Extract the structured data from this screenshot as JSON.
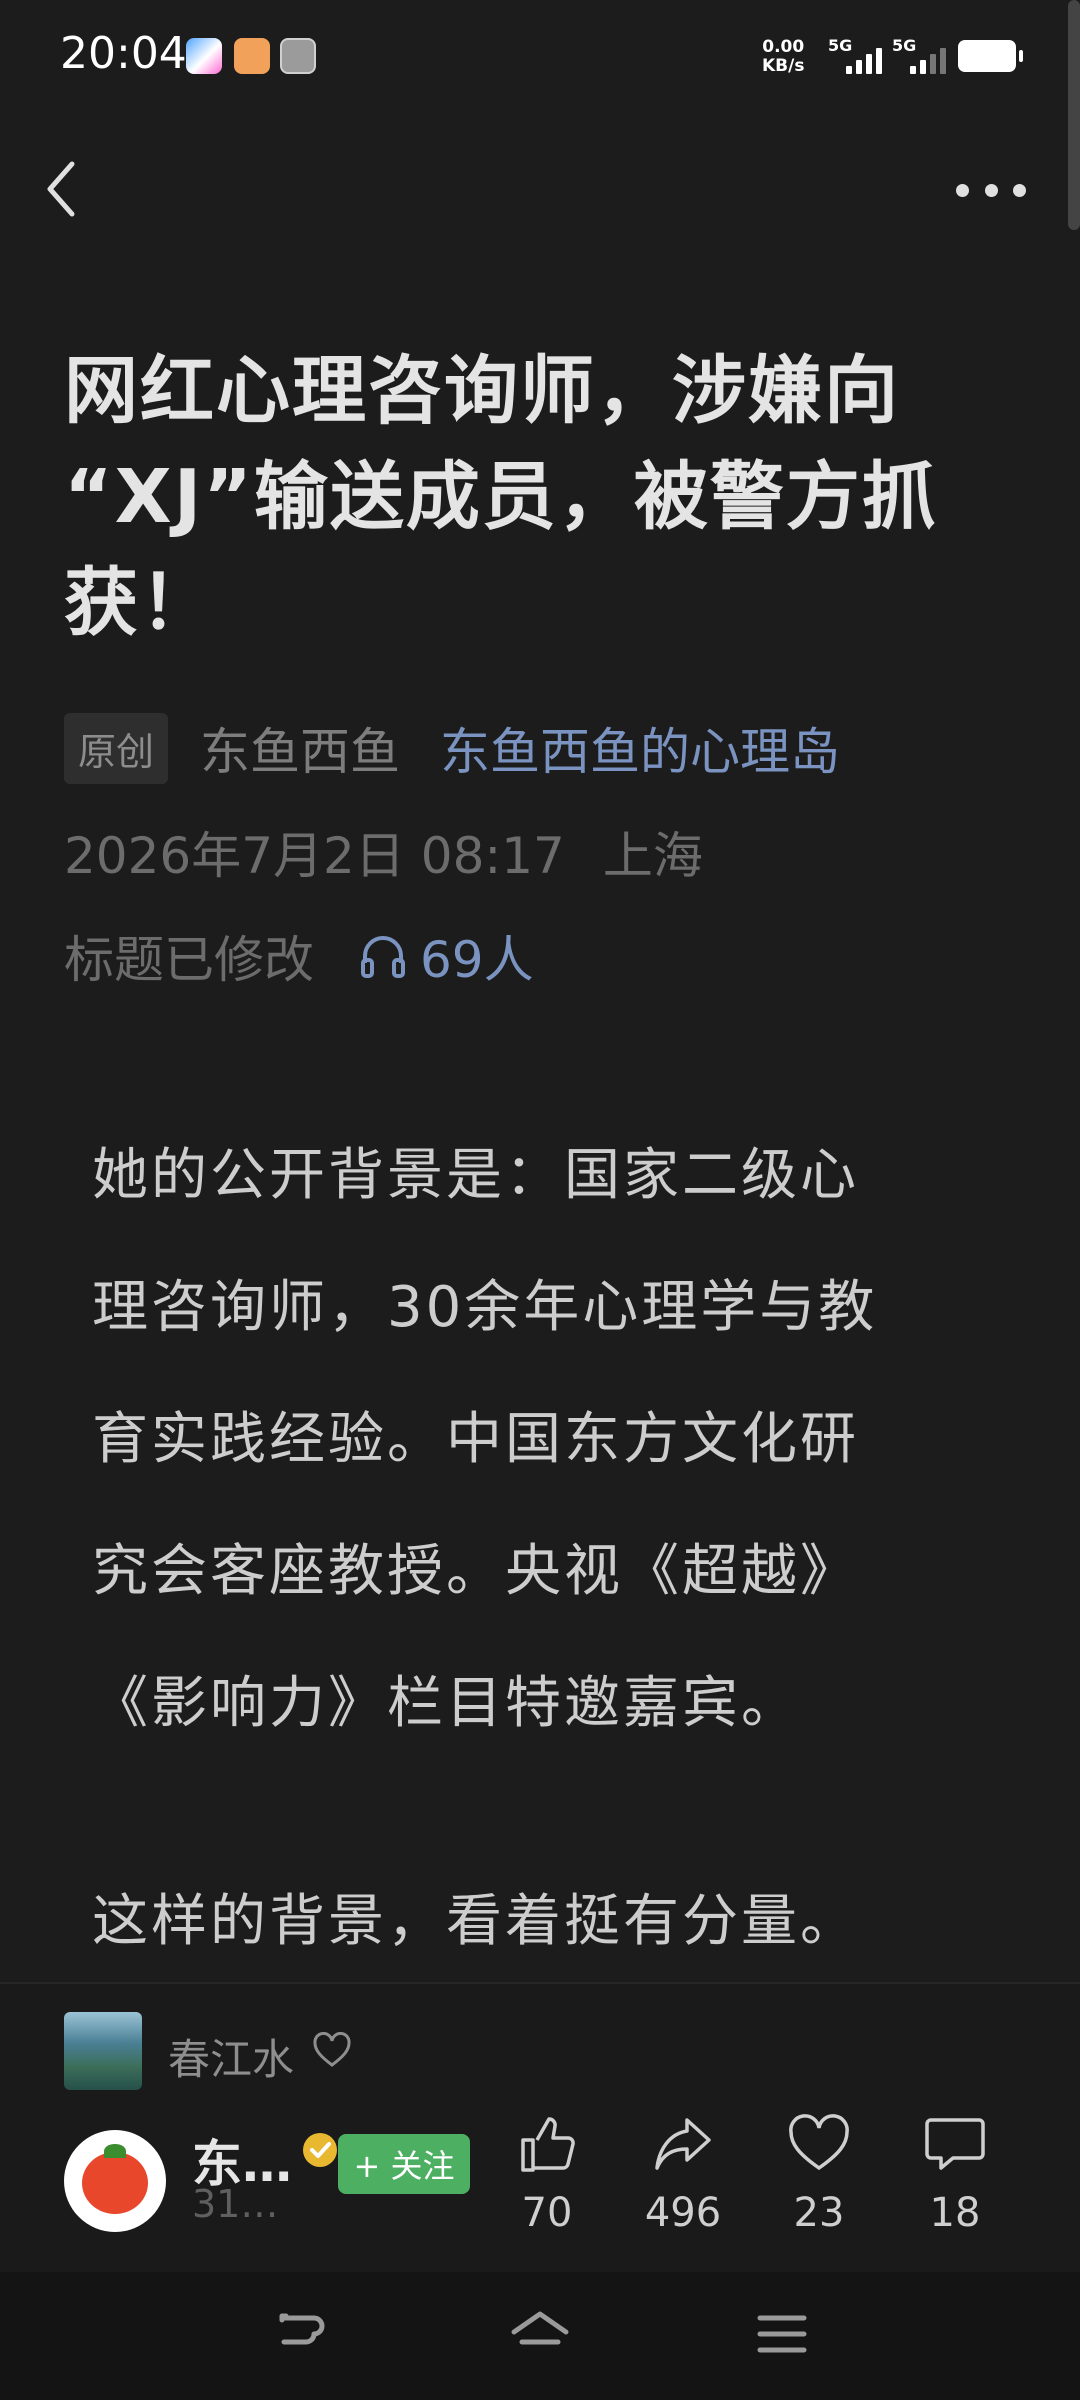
{
  "status_bar": {
    "time": "20:04",
    "net_speed_value": "0.00",
    "net_speed_unit": "KB/s",
    "network1": "5G",
    "network2": "5G"
  },
  "nav": {
    "back_icon": "chevron-left-icon",
    "more_icon": "more-horizontal-icon"
  },
  "article": {
    "title_line1": "网红心理咨询师，涉嫌向",
    "title_line2": "“XJ”输送成员，被警方抓",
    "title_line3": "获！",
    "badge": "原创",
    "author": "东鱼西鱼",
    "account": "东鱼西鱼的心理岛",
    "datetime": "2026年7月2日 08:17",
    "location": "上海",
    "edited": "标题已修改",
    "listeners": "69人",
    "paragraph1_lines": [
      "她的公开背景是：国家二级心",
      "理咨询师，30余年心理学与教",
      "育实践经验。中国东方文化研",
      "究会客座教授。央视《超越》",
      "《影响力》栏目特邀嘉宾。"
    ],
    "paragraph2": "这样的背景，看着挺有分量。"
  },
  "music": {
    "title": "春江水"
  },
  "author_bar": {
    "name": "东…",
    "sub": "31…",
    "follow_label": "+ 关注"
  },
  "actions": {
    "like_count": "70",
    "share_count": "496",
    "favorite_count": "23",
    "comment_count": "18"
  },
  "colors": {
    "background": "#1c1c1c",
    "link_blue": "#7a93c0",
    "follow_green": "#4caf62"
  }
}
